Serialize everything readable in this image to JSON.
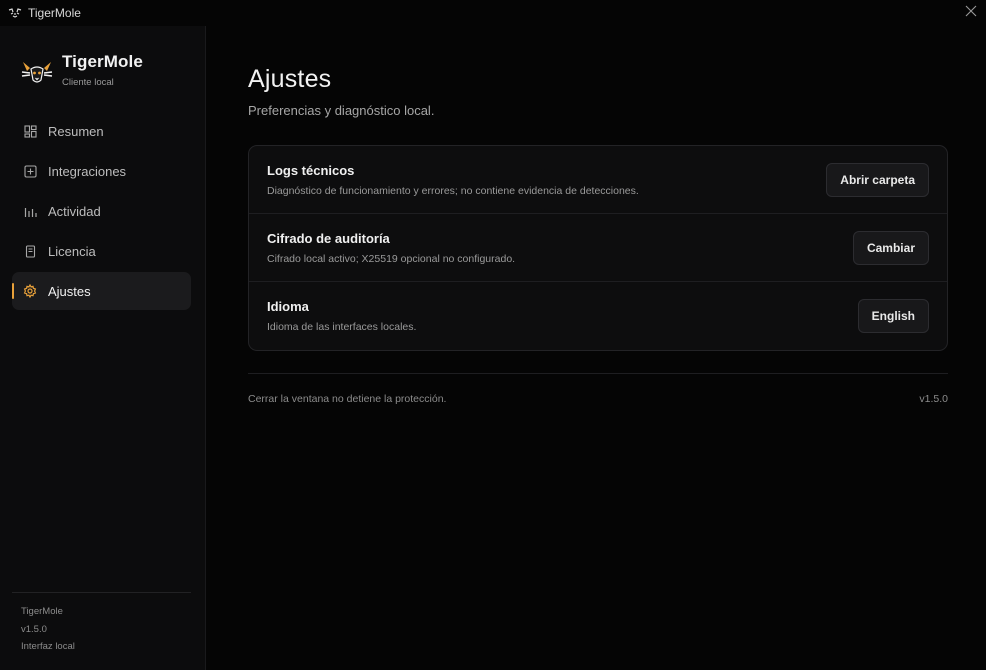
{
  "window": {
    "title": "TigerMole",
    "app_icon": "tiger-icon",
    "close_icon": "close-icon"
  },
  "sidebar": {
    "brand_name": "TigerMole",
    "brand_subtitle": "Cliente local",
    "items": [
      {
        "label": "Resumen",
        "icon": "dashboard-icon",
        "active": false
      },
      {
        "label": "Integraciones",
        "icon": "plus-square-icon",
        "active": false
      },
      {
        "label": "Actividad",
        "icon": "bar-chart-icon",
        "active": false
      },
      {
        "label": "Licencia",
        "icon": "document-icon",
        "active": false
      },
      {
        "label": "Ajustes",
        "icon": "gear-icon",
        "active": true
      }
    ],
    "footer": {
      "name": "TigerMole",
      "version": "v1.5.0",
      "mode": "Interfaz local"
    }
  },
  "main": {
    "title": "Ajustes",
    "subtitle": "Preferencias y diagnóstico local.",
    "settings": [
      {
        "title": "Logs técnicos",
        "description": "Diagnóstico de funcionamiento y errores; no contiene evidencia de detecciones.",
        "button": "Abrir carpeta"
      },
      {
        "title": "Cifrado de auditoría",
        "description": "Cifrado local activo; X25519 opcional no configurado.",
        "button": "Cambiar"
      },
      {
        "title": "Idioma",
        "description": "Idioma de las interfaces locales.",
        "button": "English"
      }
    ],
    "footer_note": "Cerrar la ventana no detiene la protección.",
    "version": "v1.5.0"
  },
  "colors": {
    "background": "#050505",
    "sidebar": "#0c0c0d",
    "accent": "#e8a13a",
    "card": "#0d0d0e"
  }
}
